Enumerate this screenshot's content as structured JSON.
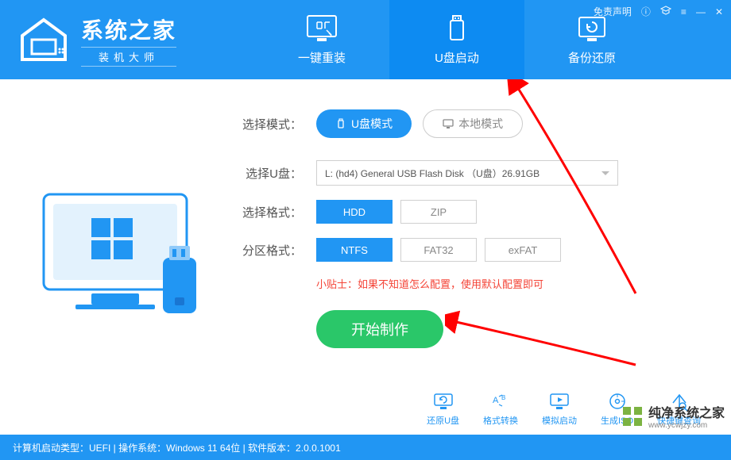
{
  "header": {
    "logo_title": "系统之家",
    "logo_sub": "装机大师",
    "disclaimer": "免责声明"
  },
  "tabs": [
    {
      "label": "一键重装",
      "active": false
    },
    {
      "label": "U盘启动",
      "active": true
    },
    {
      "label": "备份还原",
      "active": false
    }
  ],
  "form": {
    "mode_label": "选择模式：",
    "mode_options": [
      {
        "label": "U盘模式",
        "active": true
      },
      {
        "label": "本地模式",
        "active": false
      }
    ],
    "usb_label": "选择U盘：",
    "usb_value": "L: (hd4) General USB Flash Disk （U盘）26.91GB",
    "format_label": "选择格式：",
    "format_options": [
      {
        "label": "HDD",
        "active": true
      },
      {
        "label": "ZIP",
        "active": false
      }
    ],
    "partition_label": "分区格式：",
    "partition_options": [
      {
        "label": "NTFS",
        "active": true
      },
      {
        "label": "FAT32",
        "active": false
      },
      {
        "label": "exFAT",
        "active": false
      }
    ],
    "tip": "小贴士：如果不知道怎么配置，使用默认配置即可",
    "start_button": "开始制作"
  },
  "tools": [
    {
      "label": "还原U盘"
    },
    {
      "label": "格式转换"
    },
    {
      "label": "模拟启动"
    },
    {
      "label": "生成ISO"
    },
    {
      "label": "快捷键查询"
    }
  ],
  "footer": {
    "text": "计算机启动类型：UEFI | 操作系统：Windows 11 64位 | 软件版本：2.0.0.1001"
  },
  "watermark": {
    "title": "纯净系统之家",
    "url": "www.ycwjzy.com"
  }
}
